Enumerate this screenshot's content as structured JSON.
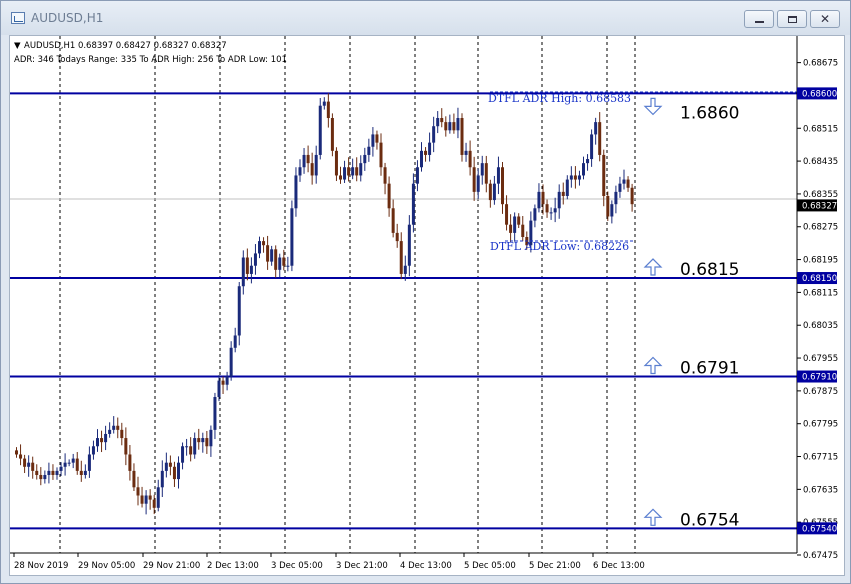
{
  "window": {
    "title": "AUDUSD,H1"
  },
  "header": {
    "line1": "AUDUSD,H1  0.68397 0.68427 0.68327 0.68327",
    "line2": "ADR: 346  Todays Range: 335  To ADR High: 256  To ADR Low: 101"
  },
  "annotations": {
    "adr_high": "DTFL ADR High: 0.68583",
    "adr_low": "DTFL ADR Low: 0.68226"
  },
  "price_scale": {
    "ticks": [
      "0.68675",
      "0.68515",
      "0.68435",
      "0.68355",
      "0.68275",
      "0.68195",
      "0.68115",
      "0.68035",
      "0.67955",
      "0.67875",
      "0.67795",
      "0.67715",
      "0.67635",
      "0.67555",
      "0.67475"
    ],
    "current_price": "0.68327",
    "level_labels": [
      "0.68600",
      "0.68150",
      "0.67910",
      "0.67540"
    ]
  },
  "levels": [
    {
      "price": 0.686,
      "label": "1.6860",
      "direction": "down"
    },
    {
      "price": 0.6815,
      "label": "0.6815",
      "direction": "up"
    },
    {
      "price": 0.6791,
      "label": "0.6791",
      "direction": "up"
    },
    {
      "price": 0.6754,
      "label": "0.6754",
      "direction": "up"
    }
  ],
  "time_axis": [
    "28 Nov 2019",
    "29 Nov 05:00",
    "29 Nov 21:00",
    "2 Dec 13:00",
    "3 Dec 05:00",
    "3 Dec 21:00",
    "4 Dec 13:00",
    "5 Dec 05:00",
    "5 Dec 21:00",
    "6 Dec 13:00"
  ],
  "colors": {
    "level_line": "#0000a0",
    "bull_candle": "#1a2a7a",
    "bear_candle": "#6b2c10",
    "grid": "#000000",
    "annotation": "#1a35c8"
  },
  "chart_data": {
    "type": "candlestick",
    "symbol": "AUDUSD",
    "timeframe": "H1",
    "ylim": [
      0.67475,
      0.68735
    ],
    "closes": [
      0.6772,
      0.6771,
      0.6769,
      0.677,
      0.6768,
      0.6767,
      0.6766,
      0.6767,
      0.6768,
      0.6767,
      0.6768,
      0.6769,
      0.677,
      0.677,
      0.6771,
      0.6768,
      0.6767,
      0.6768,
      0.6772,
      0.6774,
      0.6776,
      0.6775,
      0.6777,
      0.6778,
      0.6779,
      0.6778,
      0.6776,
      0.6772,
      0.6768,
      0.6764,
      0.6762,
      0.676,
      0.6762,
      0.6761,
      0.6759,
      0.6764,
      0.6768,
      0.677,
      0.6769,
      0.6766,
      0.677,
      0.6774,
      0.6774,
      0.6772,
      0.6776,
      0.6775,
      0.6776,
      0.6774,
      0.6778,
      0.6786,
      0.679,
      0.6789,
      0.6791,
      0.6798,
      0.6801,
      0.6813,
      0.682,
      0.6816,
      0.6818,
      0.6821,
      0.6824,
      0.6823,
      0.6819,
      0.6822,
      0.6817,
      0.682,
      0.6818,
      0.6818,
      0.6832,
      0.684,
      0.6842,
      0.6845,
      0.6843,
      0.684,
      0.6845,
      0.6857,
      0.6858,
      0.6854,
      0.6846,
      0.684,
      0.6839,
      0.6842,
      0.684,
      0.6842,
      0.684,
      0.6843,
      0.6845,
      0.6847,
      0.685,
      0.6848,
      0.6842,
      0.6838,
      0.6832,
      0.6826,
      0.6824,
      0.6816,
      0.6818,
      0.6828,
      0.6838,
      0.6842,
      0.6846,
      0.6845,
      0.6848,
      0.6852,
      0.6854,
      0.6853,
      0.6851,
      0.6853,
      0.6851,
      0.6854,
      0.6845,
      0.6846,
      0.6842,
      0.6836,
      0.684,
      0.6843,
      0.6838,
      0.6834,
      0.6838,
      0.6842,
      0.6833,
      0.6828,
      0.6826,
      0.683,
      0.6828,
      0.6825,
      0.6823,
      0.6829,
      0.6832,
      0.6836,
      0.6833,
      0.6831,
      0.6831,
      0.6832,
      0.6836,
      0.6835,
      0.6839,
      0.684,
      0.6839,
      0.684,
      0.6843,
      0.6844,
      0.685,
      0.6853,
      0.6845,
      0.6835,
      0.683,
      0.6833,
      0.6836,
      0.6838,
      0.6839,
      0.6837,
      0.6833
    ]
  }
}
